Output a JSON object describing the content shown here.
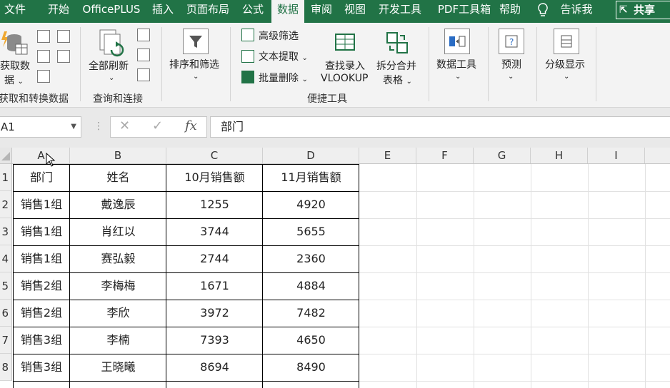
{
  "menu": {
    "tabs": [
      "文件",
      "开始",
      "OfficePLUS",
      "插入",
      "页面布局",
      "公式",
      "数据",
      "审阅",
      "视图",
      "开发工具",
      "PDF工具箱",
      "帮助"
    ],
    "active": "数据",
    "tell_me": "告诉我",
    "share": "共享"
  },
  "ribbon": {
    "get_data": {
      "label1": "获取数",
      "label2": "据",
      "group": "获取和转换数据"
    },
    "refresh": {
      "label": "全部刷新",
      "group": "查询和连接"
    },
    "sort_filter": {
      "label": "排序和筛选"
    },
    "advanced_filter": "高级筛选",
    "text_extract": "文本提取",
    "bulk_delete": "批量删除",
    "lookup": {
      "label1": "查找录入",
      "label2": "VLOOKUP"
    },
    "split_merge": {
      "label1": "拆分合并",
      "label2": "表格"
    },
    "quick_tools_group": "便捷工具",
    "data_tools": "数据工具",
    "forecast": "预测",
    "outline": "分级显示"
  },
  "formula_bar": {
    "name_box": "A1",
    "cancel": "✕",
    "enter": "✓",
    "fx": "fx",
    "formula": "部门"
  },
  "columns": [
    "A",
    "B",
    "C",
    "D",
    "E",
    "F",
    "G",
    "H",
    "I"
  ],
  "rows": [
    "1",
    "2",
    "3",
    "4",
    "5",
    "6",
    "7",
    "8"
  ],
  "table": {
    "header": [
      "部门",
      "姓名",
      "10月销售额",
      "11月销售额"
    ],
    "data": [
      [
        "销售1组",
        "戴逸辰",
        "1255",
        "4920"
      ],
      [
        "销售1组",
        "肖红以",
        "3744",
        "5655"
      ],
      [
        "销售1组",
        "赛弘毅",
        "2744",
        "2360"
      ],
      [
        "销售2组",
        "李梅梅",
        "1671",
        "4884"
      ],
      [
        "销售2组",
        "李欣",
        "3972",
        "7482"
      ],
      [
        "销售3组",
        "李楠",
        "7393",
        "4650"
      ],
      [
        "销售3组",
        "王晓曦",
        "8694",
        "8490"
      ]
    ]
  },
  "colors": {
    "excel_green": "#217346",
    "ribbon_bg": "#f3f3f3"
  }
}
